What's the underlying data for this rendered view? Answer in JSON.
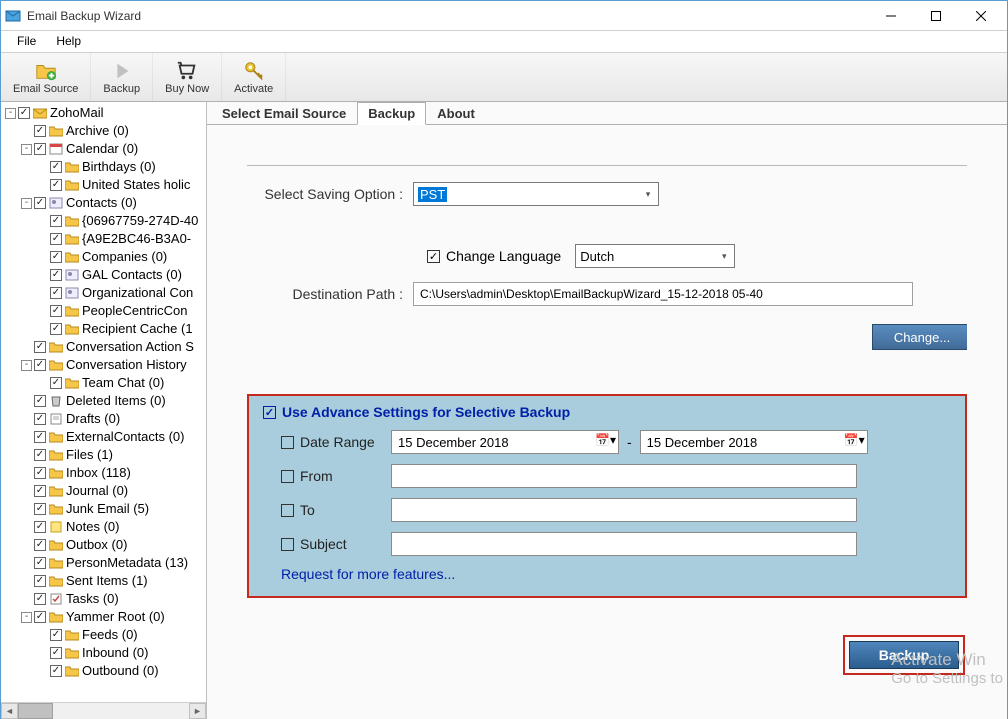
{
  "window": {
    "title": "Email Backup Wizard"
  },
  "menu": {
    "file": "File",
    "help": "Help"
  },
  "toolbar": {
    "email_source": "Email Source",
    "backup": "Backup",
    "buy_now": "Buy Now",
    "activate": "Activate"
  },
  "tree": [
    {
      "depth": 0,
      "exp": "-",
      "label": "ZohoMail",
      "icon": "mailbox"
    },
    {
      "depth": 1,
      "exp": "",
      "label": "Archive (0)",
      "icon": "folder"
    },
    {
      "depth": 1,
      "exp": "-",
      "label": "Calendar (0)",
      "icon": "calendar"
    },
    {
      "depth": 2,
      "exp": "",
      "label": "Birthdays (0)",
      "icon": "folder"
    },
    {
      "depth": 2,
      "exp": "",
      "label": "United States holic",
      "icon": "folder"
    },
    {
      "depth": 1,
      "exp": "-",
      "label": "Contacts (0)",
      "icon": "contacts"
    },
    {
      "depth": 2,
      "exp": "",
      "label": "{06967759-274D-40",
      "icon": "folder"
    },
    {
      "depth": 2,
      "exp": "",
      "label": "{A9E2BC46-B3A0-",
      "icon": "folder"
    },
    {
      "depth": 2,
      "exp": "",
      "label": "Companies (0)",
      "icon": "folder"
    },
    {
      "depth": 2,
      "exp": "",
      "label": "GAL Contacts (0)",
      "icon": "contacts"
    },
    {
      "depth": 2,
      "exp": "",
      "label": "Organizational Con",
      "icon": "contacts"
    },
    {
      "depth": 2,
      "exp": "",
      "label": "PeopleCentricCon",
      "icon": "folder"
    },
    {
      "depth": 2,
      "exp": "",
      "label": "Recipient Cache (1",
      "icon": "folder"
    },
    {
      "depth": 1,
      "exp": "",
      "label": "Conversation Action S",
      "icon": "folder"
    },
    {
      "depth": 1,
      "exp": "-",
      "label": "Conversation History",
      "icon": "folder"
    },
    {
      "depth": 2,
      "exp": "",
      "label": "Team Chat (0)",
      "icon": "folder"
    },
    {
      "depth": 1,
      "exp": "",
      "label": "Deleted Items (0)",
      "icon": "trash"
    },
    {
      "depth": 1,
      "exp": "",
      "label": "Drafts (0)",
      "icon": "drafts"
    },
    {
      "depth": 1,
      "exp": "",
      "label": "ExternalContacts (0)",
      "icon": "folder"
    },
    {
      "depth": 1,
      "exp": "",
      "label": "Files (1)",
      "icon": "folder"
    },
    {
      "depth": 1,
      "exp": "",
      "label": "Inbox (118)",
      "icon": "folder"
    },
    {
      "depth": 1,
      "exp": "",
      "label": "Journal (0)",
      "icon": "folder"
    },
    {
      "depth": 1,
      "exp": "",
      "label": "Junk Email (5)",
      "icon": "folder"
    },
    {
      "depth": 1,
      "exp": "",
      "label": "Notes (0)",
      "icon": "notes"
    },
    {
      "depth": 1,
      "exp": "",
      "label": "Outbox (0)",
      "icon": "folder"
    },
    {
      "depth": 1,
      "exp": "",
      "label": "PersonMetadata (13)",
      "icon": "folder"
    },
    {
      "depth": 1,
      "exp": "",
      "label": "Sent Items (1)",
      "icon": "folder"
    },
    {
      "depth": 1,
      "exp": "",
      "label": "Tasks (0)",
      "icon": "tasks"
    },
    {
      "depth": 1,
      "exp": "-",
      "label": "Yammer Root (0)",
      "icon": "folder"
    },
    {
      "depth": 2,
      "exp": "",
      "label": "Feeds (0)",
      "icon": "folder"
    },
    {
      "depth": 2,
      "exp": "",
      "label": "Inbound (0)",
      "icon": "folder"
    },
    {
      "depth": 2,
      "exp": "",
      "label": "Outbound (0)",
      "icon": "folder"
    }
  ],
  "tabs": {
    "select_source": "Select Email Source",
    "backup": "Backup",
    "about": "About"
  },
  "form": {
    "saving_option_label": "Select Saving Option :",
    "saving_option_value": "PST",
    "change_language_label": "Change Language",
    "language_value": "Dutch",
    "destination_label": "Destination Path :",
    "destination_value": "C:\\Users\\admin\\Desktop\\EmailBackupWizard_15-12-2018 05-40",
    "change_button": "Change..."
  },
  "advanced": {
    "title": "Use Advance Settings for Selective Backup",
    "date_range_label": "Date Range",
    "date_from": "15  December  2018",
    "date_to": "15  December  2018",
    "from_label": "From",
    "to_label": "To",
    "subject_label": "Subject",
    "request_link": "Request for more features..."
  },
  "backup_button": "Backup",
  "watermark": {
    "line1": "Activate Win",
    "line2": "Go to Settings to"
  }
}
